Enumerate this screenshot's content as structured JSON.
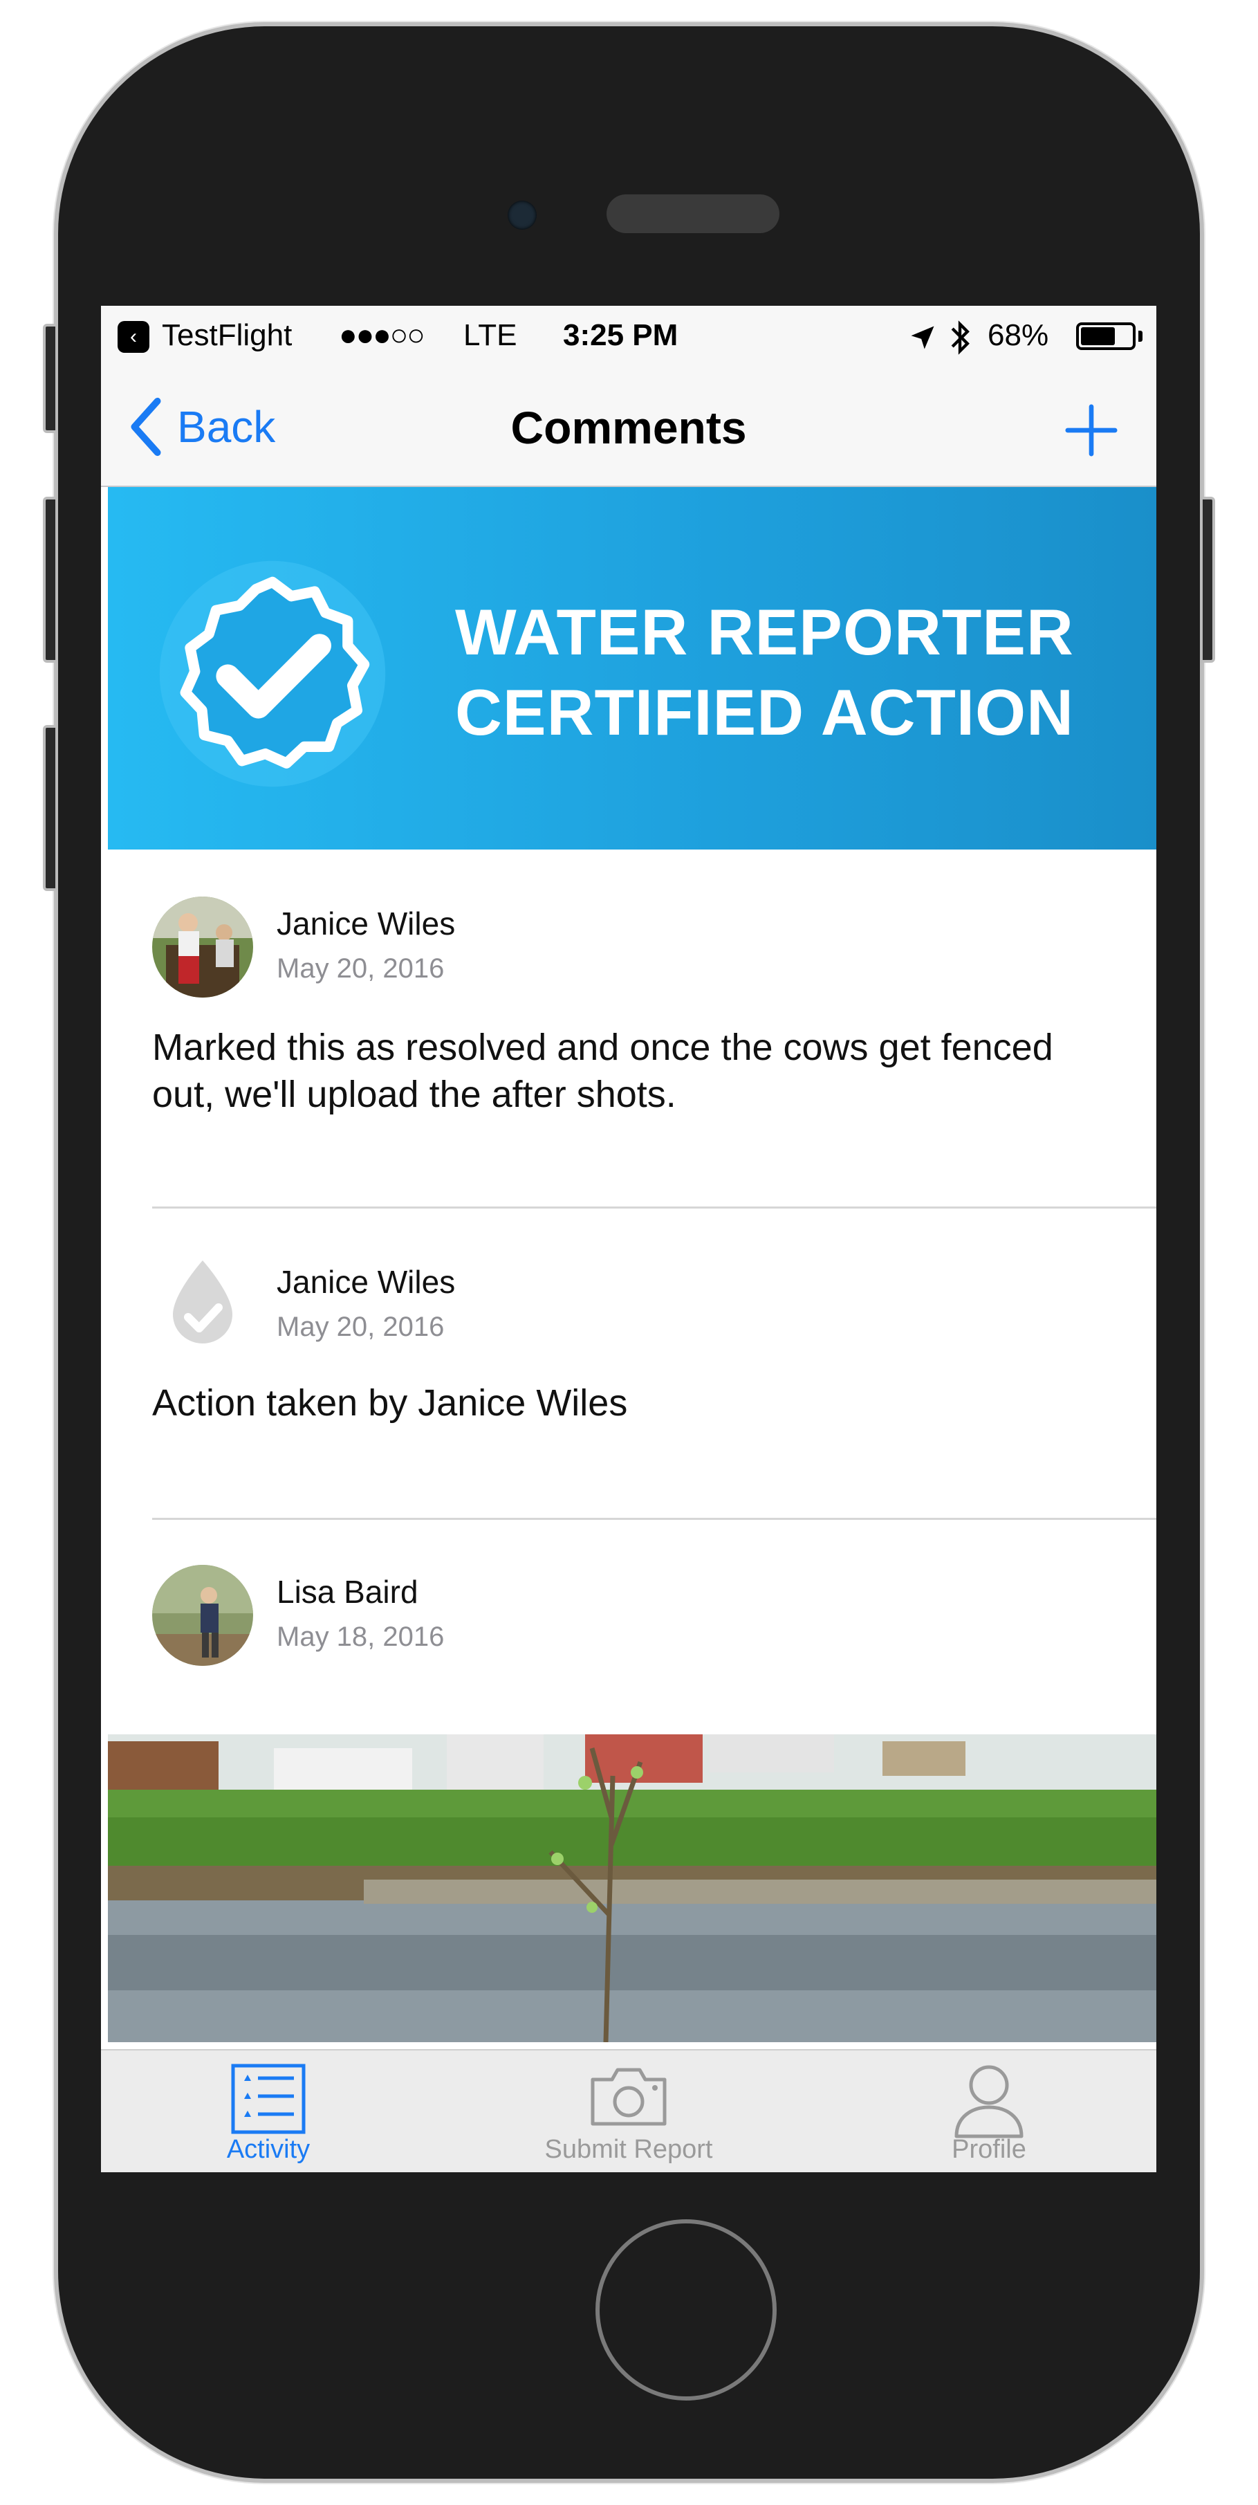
{
  "status_bar": {
    "carrier_app": "TestFlight",
    "signal": "●●●○○",
    "network": "LTE",
    "time": "3:25 PM",
    "battery_percent": "68%",
    "battery_level": 0.68
  },
  "nav": {
    "back_label": "Back",
    "title": "Comments"
  },
  "banner": {
    "line1": "WATER REPORTER",
    "line2": "CERTIFIED ACTION",
    "color": "#26baf2"
  },
  "comments": [
    {
      "author": "Janice Wiles",
      "date": "May 20, 2016",
      "text": "Marked this as resolved and once the cows get fenced out, we'll upload the after shots."
    },
    {
      "author": "Janice Wiles",
      "date": "May 20, 2016",
      "text": "Action taken by Janice Wiles"
    },
    {
      "author": "Lisa Baird",
      "date": "May 18, 2016"
    }
  ],
  "tabs": [
    {
      "label": "Activity",
      "icon": "list-icon",
      "active": true
    },
    {
      "label": "Submit Report",
      "icon": "camera-icon",
      "active": false
    },
    {
      "label": "Profile",
      "icon": "person-icon",
      "active": false
    }
  ],
  "colors": {
    "accent": "#1a7bf4",
    "inactive_tab": "#9a9a9a"
  }
}
